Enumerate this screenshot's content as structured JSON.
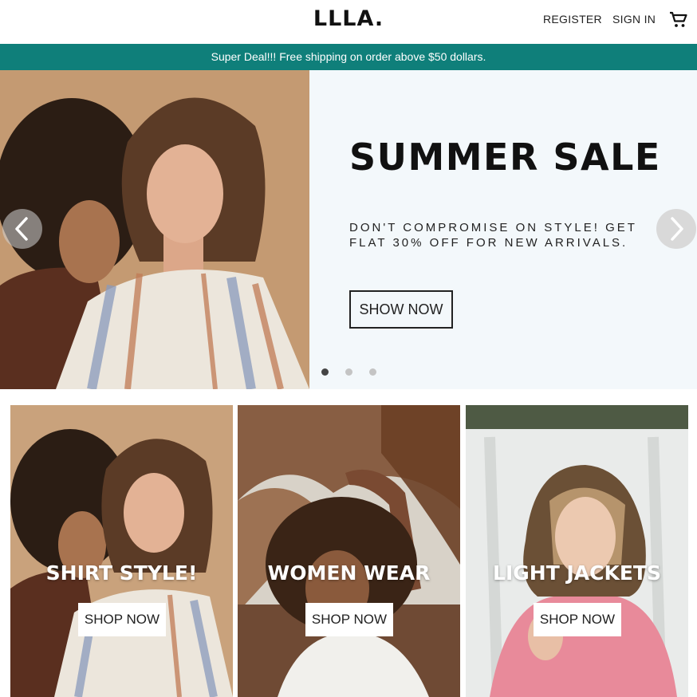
{
  "header": {
    "logo": "LLLA.",
    "register": "REGISTER",
    "sign_in": "SIGN IN",
    "cart_icon": "shopping-cart-icon"
  },
  "announcement": {
    "text": "Super Deal!!! Free shipping on order above $50 dollars.",
    "background": "#0f7f7a"
  },
  "hero": {
    "title": "SUMMER SALE",
    "description": "DON'T COMPROMISE ON STYLE! GET FLAT 30% OFF FOR NEW ARRIVALS.",
    "button": "SHOW NOW",
    "background": "#f3f8fb",
    "prev_icon": "chevron-left-icon",
    "next_icon": "chevron-right-icon",
    "slides": 3,
    "active_slide": 1
  },
  "categories": [
    {
      "title": "SHIRT STYLE!",
      "button": "SHOP NOW"
    },
    {
      "title": "WOMEN WEAR",
      "button": "SHOP NOW"
    },
    {
      "title": "LIGHT JACKETS",
      "button": "SHOP NOW"
    }
  ]
}
